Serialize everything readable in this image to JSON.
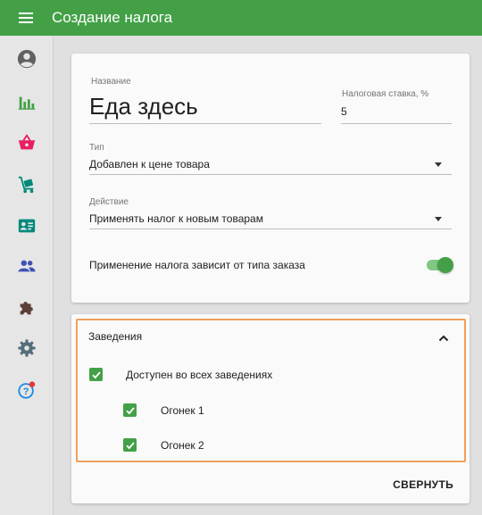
{
  "app": {
    "title": "Создание налога"
  },
  "sidebar": {
    "items": [
      {
        "name": "account-icon",
        "color": "#616161"
      },
      {
        "name": "reports-chart-icon",
        "color": "#43a047"
      },
      {
        "name": "basket-icon",
        "color": "#e91e63"
      },
      {
        "name": "cart-icon",
        "color": "#00897b"
      },
      {
        "name": "contact-card-icon",
        "color": "#00897b"
      },
      {
        "name": "people-icon",
        "color": "#3f51b5"
      },
      {
        "name": "puzzle-icon",
        "color": "#5d4037"
      },
      {
        "name": "gear-icon",
        "color": "#546e7a"
      },
      {
        "name": "help-icon",
        "color": "#1e88e5",
        "badge_color": "#e53935"
      }
    ]
  },
  "form": {
    "name_label": "Название",
    "name_value": "Еда здесь",
    "rate_label": "Налоговая ставка, %",
    "rate_value": "5",
    "type_label": "Тип",
    "type_value": "Добавлен к цене товара",
    "action_label": "Действие",
    "action_value": "Применять налог к новым товарам",
    "order_type_toggle_label": "Применение налога зависит от типа заказа",
    "order_type_toggle_on": true
  },
  "venues": {
    "title": "Заведения",
    "all_label": "Доступен во всех заведениях",
    "all_checked": true,
    "items": [
      {
        "label": "Огонек 1",
        "checked": true
      },
      {
        "label": "Огонек 2",
        "checked": true
      }
    ],
    "collapse_label": "СВЕРНУТЬ"
  },
  "colors": {
    "primary": "#43a047",
    "highlight_border": "#f0a05a"
  }
}
